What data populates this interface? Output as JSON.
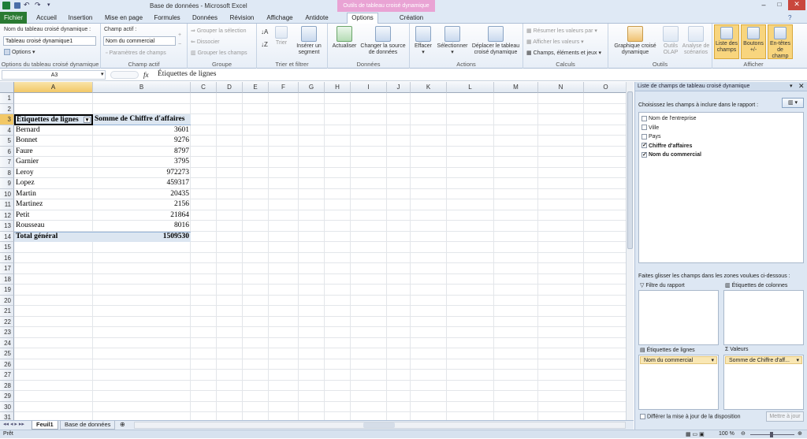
{
  "window": {
    "title": "Base de données - Microsoft Excel",
    "context_tab_group": "Outils de tableau croisé dynamique"
  },
  "tabs": [
    "Fichier",
    "Accueil",
    "Insertion",
    "Mise en page",
    "Formules",
    "Données",
    "Révision",
    "Affichage",
    "Antidote",
    "Options",
    "Création"
  ],
  "active_tab": "Options",
  "ribbon": {
    "pt_name_label": "Nom du tableau croisé dynamique :",
    "pt_name_value": "Tableau croisé dynamique1",
    "options_label": "Options",
    "active_field_label": "Champ actif :",
    "active_field_value": "Nom du commercial",
    "field_settings_label": "Paramètres de champs",
    "group_selection_label": "Grouper la sélection",
    "ungroup_label": "Dissocier",
    "group_fields_label": "Grouper les champs",
    "sort_label": "Trier",
    "insert_slicer_label": "Insérer un segment",
    "refresh_label": "Actualiser",
    "change_source_label": "Changer la source de données",
    "clear_label": "Effacer",
    "select_label": "Sélectionner",
    "move_pt_label": "Déplacer le tableau croisé dynamique",
    "summarize_label": "Résumer les valeurs par",
    "show_values_label": "Afficher les valeurs",
    "fields_items_label": "Champs, éléments et jeux",
    "pivotchart_label": "Graphique croisé dynamique",
    "olap_label": "Outils OLAP",
    "whatif_label": "Analyse de scénarios",
    "field_list_label": "Liste des champs",
    "buttons_label": "Boutons +/-",
    "headers_label": "En-têtes de champ",
    "groups": [
      "Options du tableau croisé dynamique",
      "Champ actif",
      "Groupe",
      "Trier et filtrer",
      "Données",
      "Actions",
      "Calculs",
      "Outils",
      "Afficher"
    ]
  },
  "formula_bar": {
    "name_box": "A3",
    "fx": "fx",
    "content": "Étiquettes de lignes"
  },
  "columns": [
    "A",
    "B",
    "C",
    "D",
    "E",
    "F",
    "G",
    "H",
    "I",
    "J",
    "K",
    "L",
    "M",
    "N",
    "O"
  ],
  "rows": [
    "1",
    "2",
    "3",
    "4",
    "5",
    "6",
    "7",
    "8",
    "9",
    "10",
    "11",
    "12",
    "13",
    "14",
    "15",
    "16",
    "17",
    "18",
    "19",
    "20",
    "21",
    "22",
    "23",
    "24",
    "25",
    "26",
    "27",
    "28",
    "29",
    "30",
    "31"
  ],
  "pivot": {
    "header_row_label": "Étiquettes de lignes",
    "header_value_label": "Somme de Chiffre d'affaires",
    "items": [
      {
        "name": "Bernard",
        "value": "3601"
      },
      {
        "name": "Bonnet",
        "value": "9276"
      },
      {
        "name": "Faure",
        "value": "8797"
      },
      {
        "name": "Garnier",
        "value": "3795"
      },
      {
        "name": "Leroy",
        "value": "972273"
      },
      {
        "name": "Lopez",
        "value": "459317"
      },
      {
        "name": "Martin",
        "value": "20435"
      },
      {
        "name": "Martinez",
        "value": "2156"
      },
      {
        "name": "Petit",
        "value": "21864"
      },
      {
        "name": "Rousseau",
        "value": "8016"
      }
    ],
    "total_label": "Total général",
    "total_value": "1509530"
  },
  "sheets": {
    "active": "Feuil1",
    "other": "Base de données"
  },
  "status": {
    "ready": "Prêt",
    "zoom": "100 %"
  },
  "field_list": {
    "title": "Liste de champs de tableau croisé dynamique",
    "choose_label": "Choisissez les champs à inclure dans le rapport :",
    "fields": [
      {
        "name": "Nom de l'entreprise",
        "checked": false
      },
      {
        "name": "Ville",
        "checked": false
      },
      {
        "name": "Pays",
        "checked": false
      },
      {
        "name": "Chiffre d'affaires",
        "checked": true
      },
      {
        "name": "Nom du commercial",
        "checked": true
      }
    ],
    "drag_label": "Faites glisser les champs dans les zones voulues ci-dessous :",
    "report_filter": "Filtre du rapport",
    "column_labels": "Étiquettes de colonnes",
    "row_labels": "Étiquettes de lignes",
    "values": "Valeurs",
    "row_item": "Nom du commercial",
    "value_item": "Somme de Chiffre d'aff...",
    "defer_label": "Différer la mise à jour de la disposition",
    "update_label": "Mettre à jour"
  }
}
